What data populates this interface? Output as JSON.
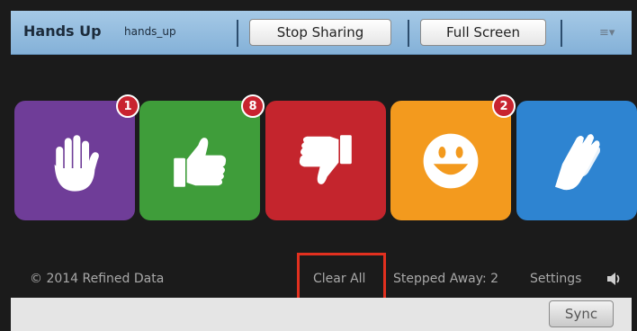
{
  "header": {
    "title": "Hands Up",
    "subtitle": "hands_up",
    "stop_sharing_label": "Stop Sharing",
    "full_screen_label": "Full Screen",
    "menu_icon": "list-menu-icon"
  },
  "tiles": [
    {
      "name": "raise-hand",
      "icon": "hand-icon",
      "color": "#6f3d98",
      "badge": "1"
    },
    {
      "name": "thumbs-up",
      "icon": "thumbs-up-icon",
      "color": "#3f9d3a",
      "badge": "8"
    },
    {
      "name": "thumbs-down",
      "icon": "thumbs-down-icon",
      "color": "#c4252d",
      "badge": ""
    },
    {
      "name": "smile",
      "icon": "smiley-icon",
      "color": "#f39a1e",
      "badge": "2"
    },
    {
      "name": "applause",
      "icon": "clapping-icon",
      "color": "#2e84d1",
      "badge": ""
    }
  ],
  "footer": {
    "copyright": "© 2014 Refined Data",
    "clear_all": "Clear All",
    "stepped_away": "Stepped Away: 2",
    "settings": "Settings",
    "audio_icon": "speaker-icon"
  },
  "bottom": {
    "sync_label": "Sync"
  }
}
